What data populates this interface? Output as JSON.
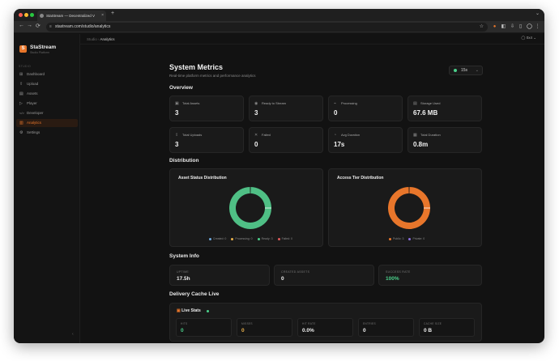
{
  "browser": {
    "tab_title": "StaStream — Decentralized V",
    "url": "stastream.com/studio/analytics",
    "new_tab": "+",
    "tab_close": "×",
    "tabs_menu": "⌄",
    "nav_back": "←",
    "nav_forward": "→",
    "nav_reload": "⟳"
  },
  "sidebar": {
    "logo": "S",
    "brand": "StaStream",
    "brand_sub": "Studio Platform",
    "section": "STUDIO",
    "items": [
      {
        "label": "Dashboard",
        "icon": "⊞"
      },
      {
        "label": "Upload",
        "icon": "⇧"
      },
      {
        "label": "Assets",
        "icon": "▤"
      },
      {
        "label": "Player",
        "icon": "▷"
      },
      {
        "label": "Developer",
        "icon": "</>"
      },
      {
        "label": "Analytics",
        "icon": "▥"
      },
      {
        "label": "Settings",
        "icon": "⚙"
      }
    ],
    "collapse": "‹"
  },
  "breadcrumb": {
    "root": "Studio",
    "separator": "›",
    "current": "Analytics"
  },
  "user": {
    "label": "0x4",
    "chevron": "⌄",
    "icon": "◯"
  },
  "page": {
    "title": "System Metrics",
    "subtitle": "Real-time platform metrics and performance analytics",
    "refresh_value": "15s",
    "refresh_chevron": "⌄"
  },
  "overview": {
    "title": "Overview",
    "stats": [
      {
        "label": "Total Assets",
        "value": "3",
        "icon": "▣"
      },
      {
        "label": "Ready to Stream",
        "value": "3",
        "icon": "◉"
      },
      {
        "label": "Processing",
        "value": "0",
        "icon": "⌁"
      },
      {
        "label": "Storage Used",
        "value": "67.6 MB",
        "icon": "▤"
      },
      {
        "label": "Total Uploads",
        "value": "3",
        "icon": "⇪"
      },
      {
        "label": "Failed",
        "value": "0",
        "icon": "✕"
      },
      {
        "label": "Avg Duration",
        "value": "17s",
        "icon": "◔"
      },
      {
        "label": "Total Duration",
        "value": "0.8m",
        "icon": "▦"
      }
    ]
  },
  "distribution": {
    "title": "Distribution",
    "charts": [
      {
        "title": "Asset Status Distribution",
        "legend": [
          {
            "label": "Created: 0",
            "color": "#6fa8dc"
          },
          {
            "label": "Processing: 0",
            "color": "#e8b04b"
          },
          {
            "label": "Ready: 3",
            "color": "#4bd08b"
          },
          {
            "label": "Failed: 0",
            "color": "#e05b5b"
          }
        ],
        "ring_color": "#4fbf85"
      },
      {
        "title": "Access Tier Distribution",
        "legend": [
          {
            "label": "Public: 3",
            "color": "#e8762b"
          },
          {
            "label": "Private: 0",
            "color": "#8a6fe0"
          }
        ],
        "ring_color": "#e8762b"
      }
    ]
  },
  "chart_data": [
    {
      "type": "pie",
      "title": "Asset Status Distribution",
      "categories": [
        "Created",
        "Processing",
        "Ready",
        "Failed"
      ],
      "values": [
        0,
        0,
        3,
        0
      ]
    },
    {
      "type": "pie",
      "title": "Access Tier Distribution",
      "categories": [
        "Public",
        "Private"
      ],
      "values": [
        3,
        0
      ]
    }
  ],
  "system_info": {
    "title": "System Info",
    "items": [
      {
        "label": "UPTIME",
        "value": "17.5h",
        "color": "#eeeeee"
      },
      {
        "label": "CREATED ASSETS",
        "value": "0",
        "color": "#eeeeee"
      },
      {
        "label": "SUCCESS RATE",
        "value": "100%",
        "color": "#4bd08b"
      }
    ]
  },
  "cache": {
    "title": "Delivery Cache Live",
    "live_title": "Live Stats",
    "icon": "▣",
    "stats": [
      {
        "label": "HITS",
        "value": "0",
        "color": "#4bd08b"
      },
      {
        "label": "MISSES",
        "value": "0",
        "color": "#e8b04b"
      },
      {
        "label": "HIT RATE",
        "value": "0.0%",
        "color": "#eeeeee"
      },
      {
        "label": "ENTRIES",
        "value": "0",
        "color": "#eeeeee"
      },
      {
        "label": "CACHE SIZE",
        "value": "0 B",
        "color": "#eeeeee"
      }
    ]
  }
}
